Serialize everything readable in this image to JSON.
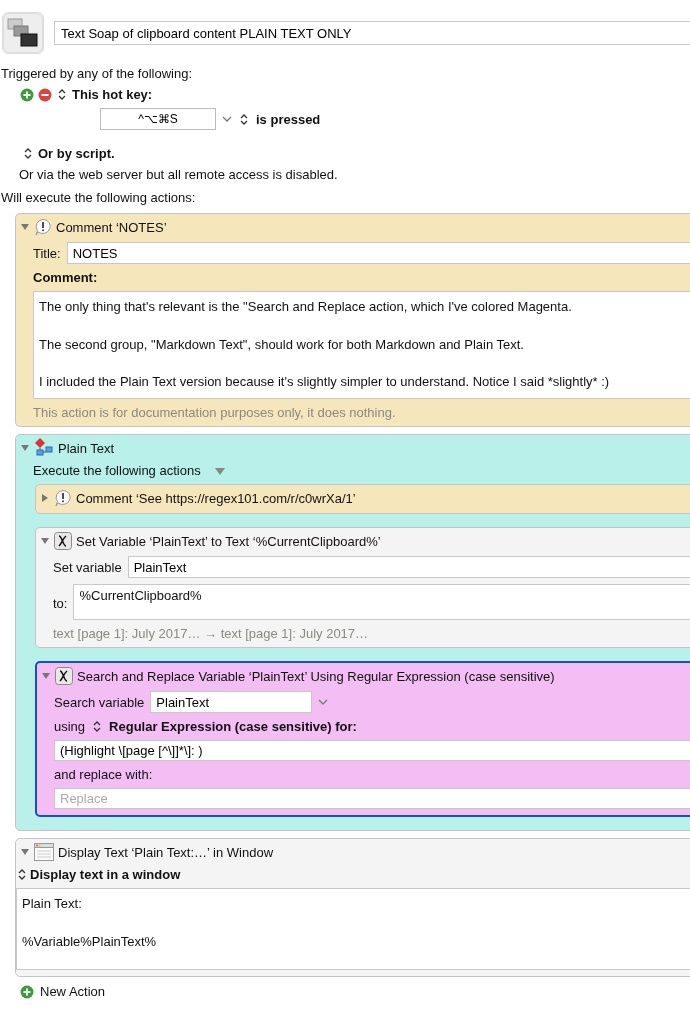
{
  "macro": {
    "name": "Text Soap of clipboard content PLAIN TEXT ONLY",
    "trigger_heading": "Triggered by any of the following:",
    "triggers": [
      {
        "kind": "hotkey",
        "label": "This hot key:",
        "key": "^⌥⌘S",
        "condition": "is pressed"
      }
    ],
    "script_trigger": "Or by script.",
    "web_note": "Or via the web server but all remote access is disabled.",
    "actions_heading": "Will execute the following actions:",
    "actions": [
      {
        "kind": "comment",
        "title": "Comment ‘NOTES’",
        "expanded": true,
        "selected": false,
        "color": "#f5e6bc",
        "title_label": "Title:",
        "title_value": "NOTES",
        "comment_label": "Comment:",
        "comment": "The only thing that's relevant is the \"Search and Replace action, which I've colored Magenta.\n\nThe second group, \"Markdown Text\", should work for both Markdown and Plain Text.\n\nI included the Plain Text version because it's slightly simpler to understand. Notice I said *slightly* :)",
        "footer": "This action is for documentation purposes only, it does nothing."
      },
      {
        "kind": "group",
        "title": "Plain Text",
        "expanded": true,
        "selected": false,
        "color": "#b9f1ea",
        "execute_label": "Execute the following actions",
        "children": [
          {
            "kind": "comment",
            "title": "Comment ‘See https://regex101.com/r/c0wrXa/1’",
            "expanded": false,
            "selected": false,
            "color": "#f5e6bc"
          },
          {
            "kind": "set_variable",
            "title": "Set Variable ‘PlainText’ to Text ‘%CurrentClipboard%’",
            "expanded": true,
            "selected": false,
            "color": "#f4f4f4",
            "var_label": "Set variable",
            "var_value": "PlainText",
            "to_label": "to:",
            "to_value": "%CurrentClipboard%",
            "footer": "text [page 1]: July 2017… → text [page 1]: July 2017…"
          },
          {
            "kind": "search_replace",
            "title": "Search and Replace Variable ‘PlainText’ Using Regular Expression (case sensitive)",
            "expanded": true,
            "selected": true,
            "color": "#f3bef3",
            "var_label": "Search variable",
            "var_value": "PlainText",
            "using_label": "using",
            "method": "Regular Expression (case sensitive) for:",
            "pattern": "(Highlight \\[page [^\\]]*\\]: )",
            "replace_label": "and replace with:",
            "replace_placeholder": "Replace"
          }
        ]
      },
      {
        "kind": "display_text",
        "title": "Display Text ‘Plain Text:…’ in Window",
        "expanded": true,
        "selected": false,
        "color": "#f4f4f4",
        "mode": "Display text in a window",
        "text": "Plain Text:\n\n%Variable%PlainText%"
      }
    ],
    "new_action": "New Action"
  }
}
